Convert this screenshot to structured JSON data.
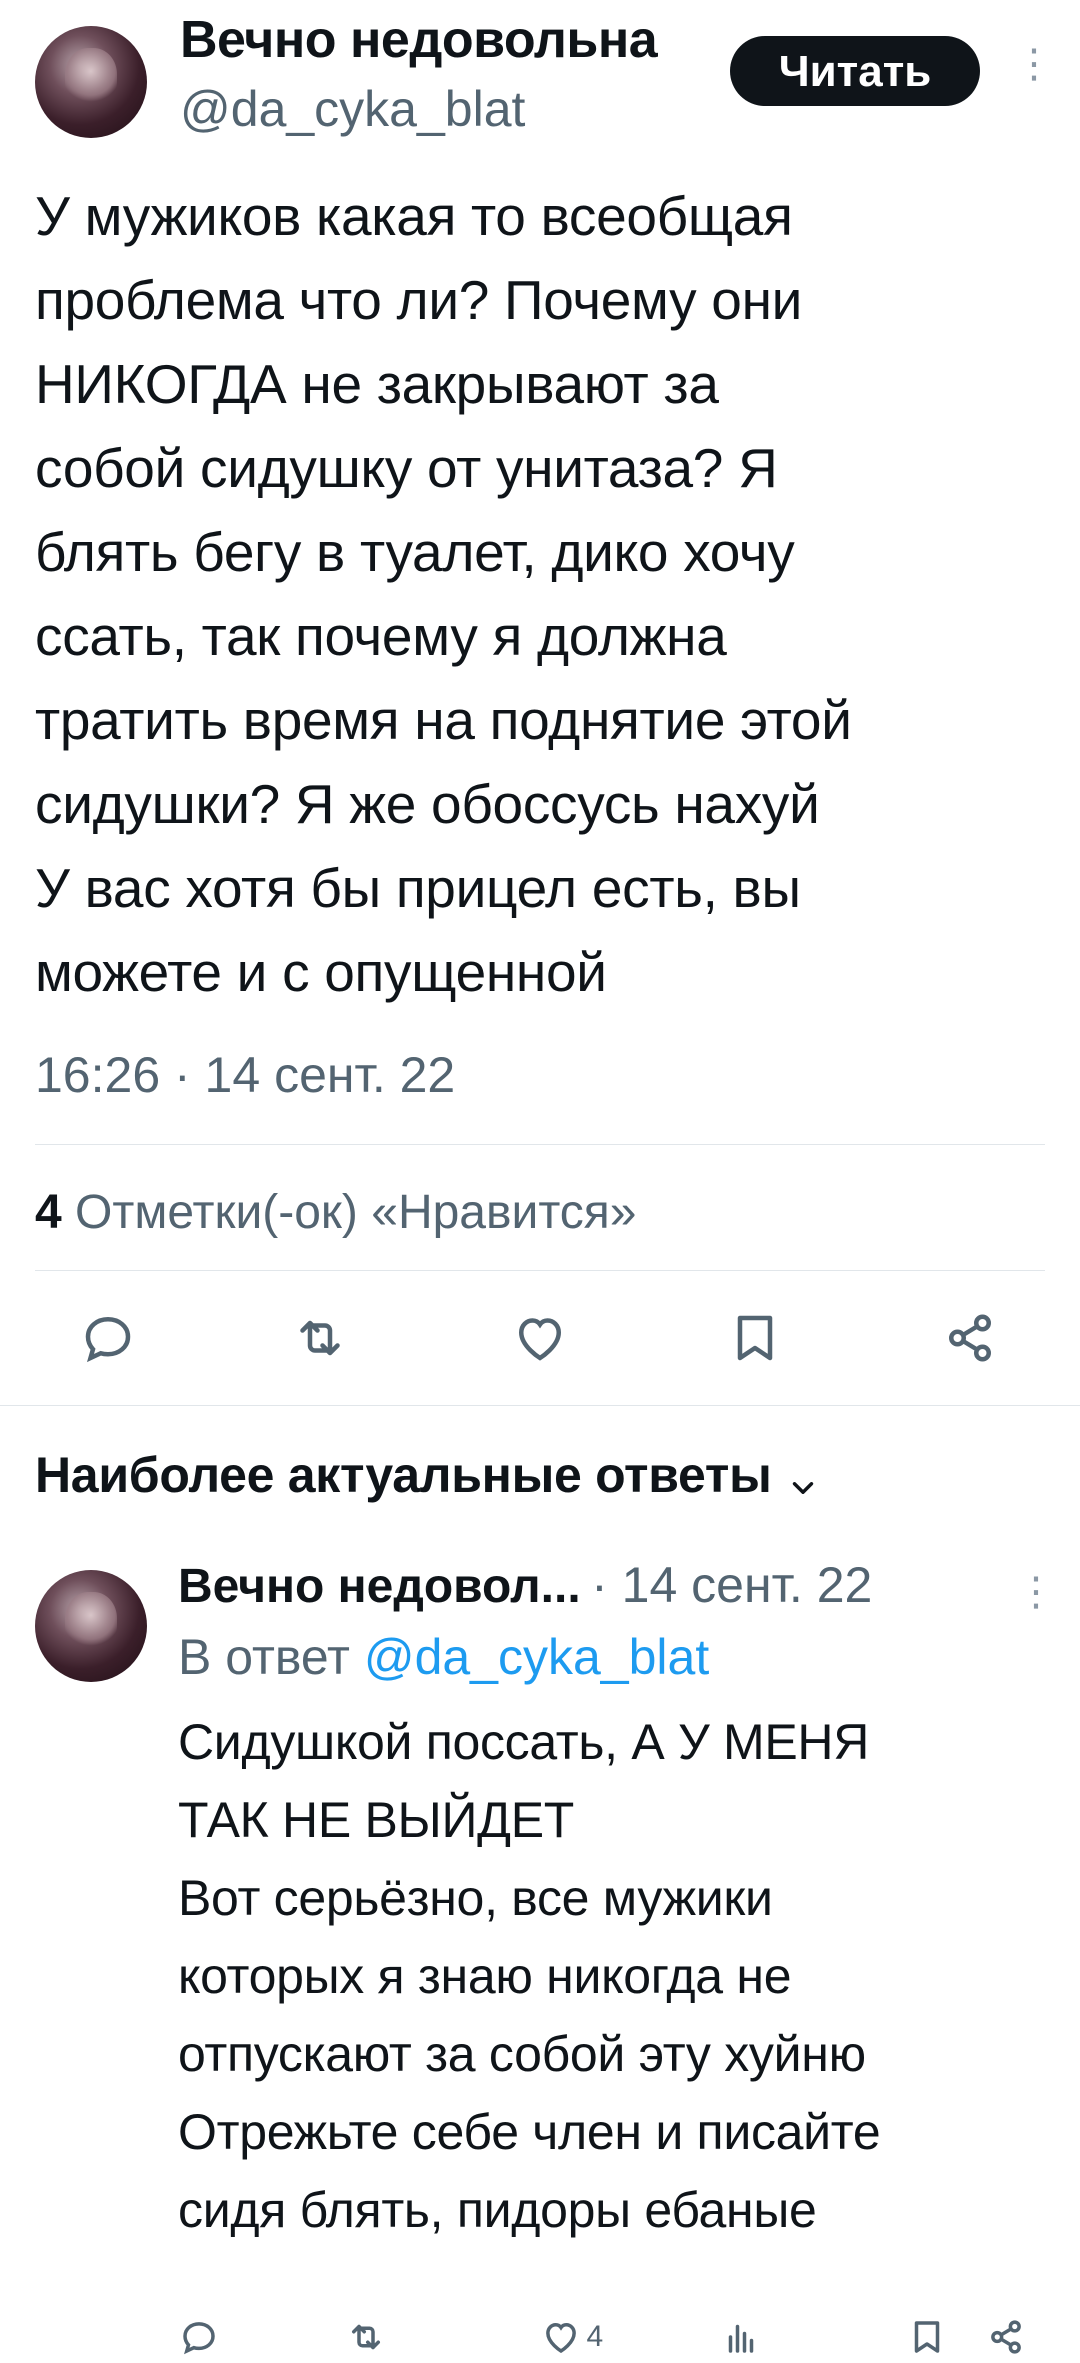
{
  "tweet": {
    "author_name": "Вечно недовольна",
    "author_handle": "@da_cyka_blat",
    "follow_label": "Читать",
    "text": "У мужиков какая то всеобщая\nпроблема что ли? Почему они\nНИКОГДА не закрывают за\nсобой сидушку от унитаза? Я\nблять бегу в туалет, дико хочу\nссать, так почему я должна\nтратить время на поднятие этой\nсидушки? Я же обоссусь нахуй\nУ вас хотя бы прицел есть, вы\nможете и с опущенной",
    "timestamp": "16:26 · 14 сент. 22",
    "likes_count": "4",
    "likes_label": "Отметки(-ок) «Нравится»",
    "actions": [
      "reply-icon",
      "retweet-icon",
      "like-icon",
      "bookmark-icon",
      "share-icon"
    ]
  },
  "replies_section": {
    "title": "Наиболее актуальные ответы"
  },
  "reply": {
    "author_name": "Вечно недовол...",
    "date": "· 14 сент. 22",
    "in_reply_prefix": "В ответ",
    "in_reply_handle": "@da_cyka_blat",
    "text": "Сидушкой поссать, А У МЕНЯ\nТАК НЕ ВЫЙДЕТ\nВот серьёзно, все мужики\nкоторых я знаю никогда не\nотпускают за собой эту хуйню\nОтрежьте себе член и писайте\nсидя блять, пидоры ебаные",
    "like_count": "4",
    "actions": [
      "reply-icon",
      "retweet-icon",
      "like-icon",
      "views-icon",
      "bookmark-icon",
      "share-icon"
    ]
  },
  "colors": {
    "text": "#0f1419",
    "secondary": "#536471",
    "link": "#1d9bf0",
    "divider": "#e1e6ea"
  }
}
